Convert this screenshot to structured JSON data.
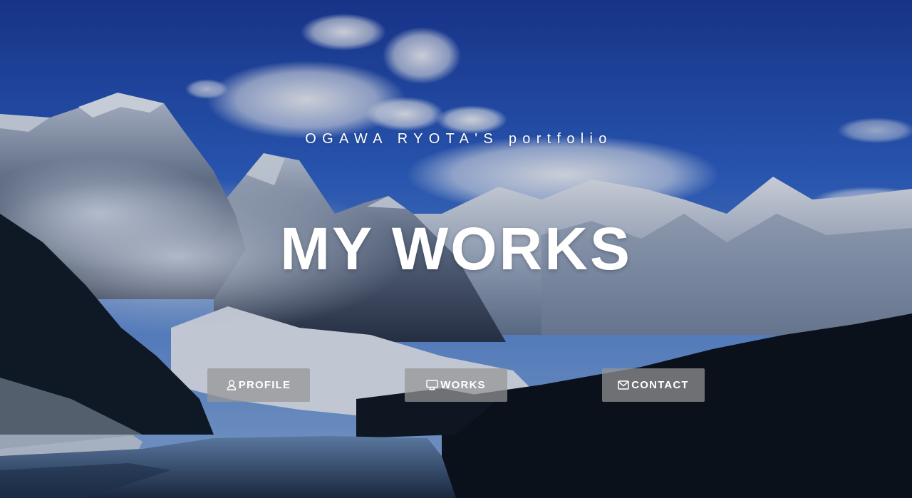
{
  "hero": {
    "subtitle": "OGAWA RYOTA'S portfolio",
    "title": "MY WORKS",
    "background": "mountain-lake-photo",
    "colors": {
      "sky": "#2a5bc4",
      "snow": "#e8eef6",
      "forest": "#0c1118",
      "lake": "#3d5f86",
      "button_bg": "rgba(150,150,150,0.72)",
      "text": "#ffffff"
    }
  },
  "nav": {
    "profile": {
      "label": "PROFILE",
      "icon": "user-icon"
    },
    "works": {
      "label": "WORKS",
      "icon": "monitor-icon"
    },
    "contact": {
      "label": "CONTACT",
      "icon": "envelope-icon"
    }
  }
}
